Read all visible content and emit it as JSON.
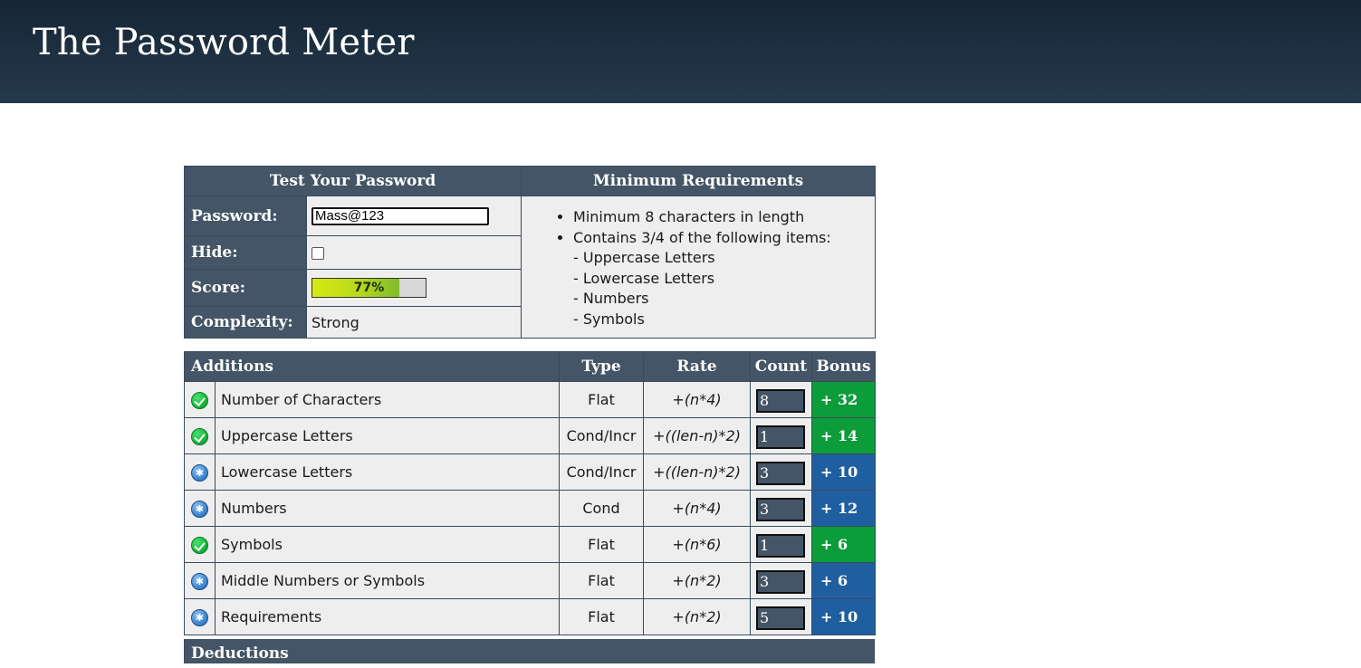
{
  "site": {
    "title": "The Password Meter"
  },
  "test": {
    "header": "Test Your Password",
    "password_label": "Password:",
    "password_value": "Mass@123",
    "hide_label": "Hide:",
    "hide_checked": false,
    "score_label": "Score:",
    "score_text": "77%",
    "score_percent": 77,
    "complexity_label": "Complexity:",
    "complexity_value": "Strong"
  },
  "requirements": {
    "header": "Minimum Requirements",
    "items": [
      "Minimum 8 characters in length",
      "Contains 3/4 of the following items:"
    ],
    "sub_items": [
      "- Uppercase Letters",
      "- Lowercase Letters",
      "- Numbers",
      "- Symbols"
    ]
  },
  "additions": {
    "headers": {
      "name": "Additions",
      "type": "Type",
      "rate": "Rate",
      "count": "Count",
      "bonus": "Bonus"
    },
    "rows": [
      {
        "status_icon": "check-icon",
        "name": "Number of Characters",
        "type": "Flat",
        "rate": "+(n*4)",
        "count": "8",
        "bonus": "+ 32",
        "bonus_color": "#0d9c3a"
      },
      {
        "status_icon": "check-icon",
        "name": "Uppercase Letters",
        "type": "Cond/Incr",
        "rate": "+((len-n)*2)",
        "count": "1",
        "bonus": "+ 14",
        "bonus_color": "#0d9c3a"
      },
      {
        "status_icon": "star-icon",
        "name": "Lowercase Letters",
        "type": "Cond/Incr",
        "rate": "+((len-n)*2)",
        "count": "3",
        "bonus": "+ 10",
        "bonus_color": "#1f5fa0"
      },
      {
        "status_icon": "star-icon",
        "name": "Numbers",
        "type": "Cond",
        "rate": "+(n*4)",
        "count": "3",
        "bonus": "+ 12",
        "bonus_color": "#1f5fa0"
      },
      {
        "status_icon": "check-icon",
        "name": "Symbols",
        "type": "Flat",
        "rate": "+(n*6)",
        "count": "1",
        "bonus": "+ 6",
        "bonus_color": "#0d9c3a"
      },
      {
        "status_icon": "star-icon",
        "name": "Middle Numbers or Symbols",
        "type": "Flat",
        "rate": "+(n*2)",
        "count": "3",
        "bonus": "+ 6",
        "bonus_color": "#1f5fa0"
      },
      {
        "status_icon": "star-icon",
        "name": "Requirements",
        "type": "Flat",
        "rate": "+(n*2)",
        "count": "5",
        "bonus": "+ 10",
        "bonus_color": "#1f5fa0"
      }
    ]
  },
  "deductions": {
    "header": "Deductions"
  }
}
